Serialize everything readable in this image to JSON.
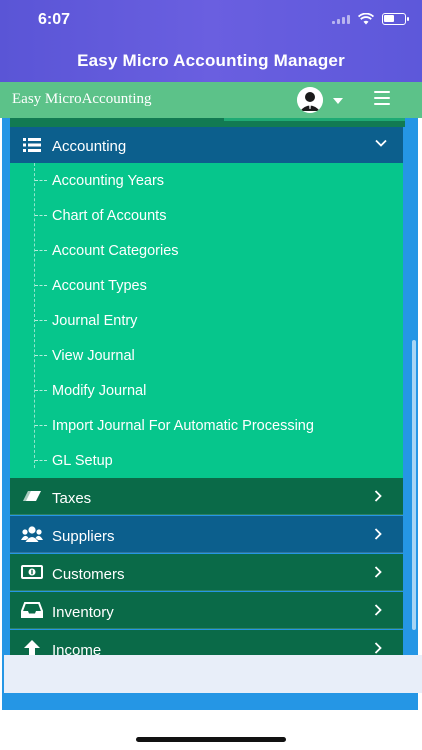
{
  "status_bar": {
    "time": "6:07"
  },
  "app": {
    "title": "Easy Micro Accounting Manager"
  },
  "header": {
    "brand": "Easy MicroAccounting"
  },
  "menu": {
    "expanded_section": "Accounting",
    "submenu": [
      "Accounting Years",
      "Chart of Accounts",
      "Account Categories",
      "Account Types",
      "Journal Entry",
      "View Journal",
      "Modify Journal",
      "Import Journal For Automatic Processing",
      "GL Setup"
    ],
    "items": [
      {
        "label": "Taxes",
        "icon": "eraser-icon"
      },
      {
        "label": "Suppliers",
        "icon": "users-icon"
      },
      {
        "label": "Customers",
        "icon": "money-icon"
      },
      {
        "label": "Inventory",
        "icon": "inbox-icon"
      },
      {
        "label": "Income",
        "icon": "arrow-up-icon"
      }
    ]
  },
  "colors": {
    "title_bar": "#5a55d6",
    "header_bar": "#5cc289",
    "section_header": "#0c5f8d",
    "submenu_bg": "#06c68c",
    "menu_item_dark": "#0a6a48",
    "menu_item_blue": "#0c5f8d",
    "panel_edge": "#2596e5"
  }
}
